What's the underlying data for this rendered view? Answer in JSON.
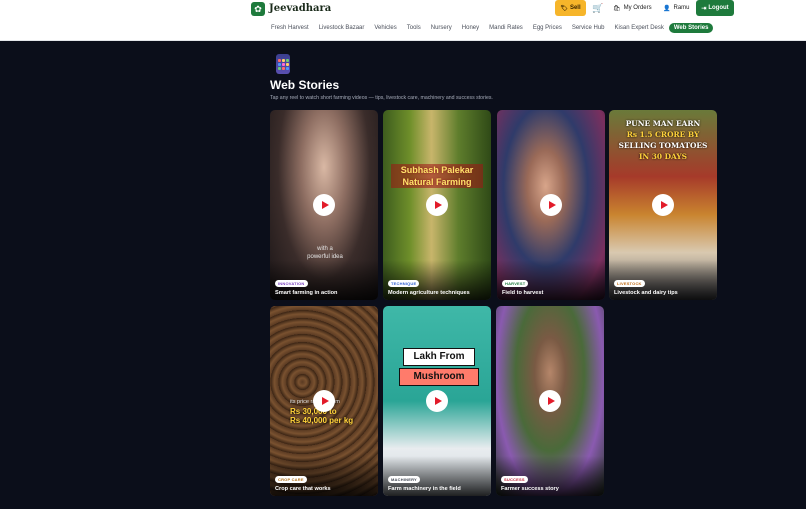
{
  "header": {
    "brand": "Jeevadhara",
    "sell_label": "Sell",
    "orders_label": "My Orders",
    "user_name": "Ramu",
    "logout_label": "Logout"
  },
  "nav": {
    "items": [
      "Fresh Harvest",
      "Livestock Bazaar",
      "Vehicles",
      "Tools",
      "Nursery",
      "Honey",
      "Mandi Rates",
      "Egg Prices",
      "Service Hub",
      "Kisan Expert Desk",
      "Web Stories"
    ],
    "active": "Web Stories"
  },
  "page": {
    "title": "Web Stories",
    "subtitle": "Tap any reel to watch short farming videos — tips, livestock care, machinery and success stories."
  },
  "reels": [
    {
      "tag": "INNOVATION",
      "tag_color": "#7b3fbf",
      "caption": "Smart farming in action",
      "overlay_lines": [
        "with a",
        "powerful idea"
      ]
    },
    {
      "tag": "TECHNIQUE",
      "tag_color": "#2f5fd0",
      "caption": "Modern agriculture techniques",
      "overlay_lines": [
        "Subhash Palekar",
        "Natural Farming"
      ]
    },
    {
      "tag": "HARVEST",
      "tag_color": "#1e7a3c",
      "caption": "Field to harvest",
      "overlay_lines": []
    },
    {
      "tag": "LIVESTOCK",
      "tag_color": "#c26a12",
      "caption": "Livestock and dairy tips",
      "overlay_lines": [
        "PUNE MAN EARN",
        "Rs 1.5 CRORE BY",
        "SELLING TOMATOES",
        "IN 30 DAYS"
      ]
    },
    {
      "tag": "CROP CARE",
      "tag_color": "#b5731a",
      "caption": "Crop care that works",
      "overlay_lines": [
        "its price ranges from",
        "Rs 30,000 to",
        "Rs 40,000 per kg"
      ]
    },
    {
      "tag": "MACHINERY",
      "tag_color": "#444a56",
      "caption": "Farm machinery in the field",
      "overlay_lines": [
        "Lakh From",
        "Mushroom"
      ]
    },
    {
      "tag": "SUCCESS",
      "tag_color": "#c2263a",
      "caption": "Farmer success story",
      "overlay_lines": []
    }
  ]
}
